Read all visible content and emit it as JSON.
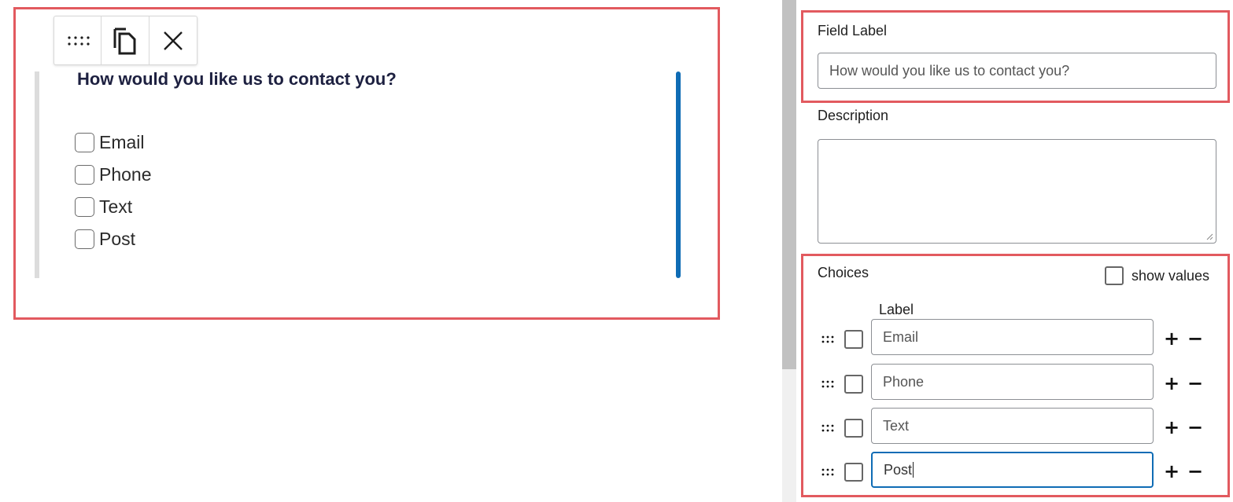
{
  "preview": {
    "toolbar": {
      "drag_icon": "drag-handle-icon",
      "duplicate_icon": "duplicate-icon",
      "close_icon": "close-icon"
    },
    "question": "How would you like us to contact you?",
    "options": [
      "Email",
      "Phone",
      "Text",
      "Post"
    ]
  },
  "inspector": {
    "field_label": {
      "label": "Field Label",
      "value": "How would you like us to contact you?"
    },
    "description": {
      "label": "Description",
      "value": ""
    },
    "choices": {
      "label": "Choices",
      "show_values_label": "show values",
      "column_label": "Label",
      "items": [
        "Email",
        "Phone",
        "Text",
        "Post"
      ],
      "add_symbol": "+",
      "remove_symbol": "−"
    }
  },
  "colors": {
    "highlight_outline": "#e25a5f",
    "accent_blue": "#0f6cb5",
    "question_text": "#1d2040"
  }
}
